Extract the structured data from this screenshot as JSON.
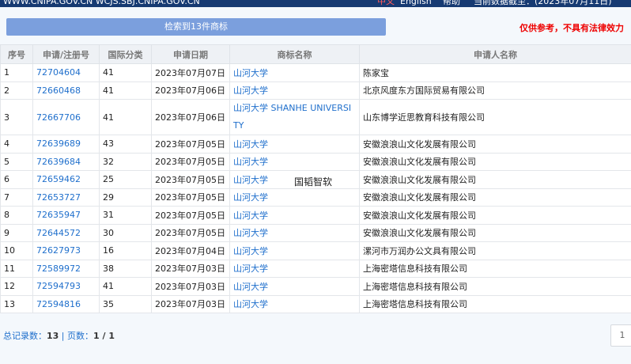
{
  "header": {
    "site": "WWW.CNIPA.GOV.CN  WCJS.SBJ.CNIPA.GOV.CN",
    "lang_zh": "中文",
    "lang_en": "English",
    "help": "帮助",
    "data_as_of": "当前数据截至：(2023年07月11日)"
  },
  "search_result_bar": "检索到13件商标",
  "disclaimer": "仅供参考，不具有法律效力",
  "table": {
    "headers": [
      "序号",
      "申请/注册号",
      "国际分类",
      "申请日期",
      "商标名称",
      "申请人名称"
    ],
    "rows": [
      [
        "1",
        "72704604",
        "41",
        "2023年07月07日",
        "山河大学",
        "陈家宝"
      ],
      [
        "2",
        "72660468",
        "41",
        "2023年07月06日",
        "山河大学",
        "北京风度东方国际贸易有限公司"
      ],
      [
        "3",
        "72667706",
        "41",
        "2023年07月06日",
        "山河大学 SHANHE UNIVERSITY",
        "山东博学近思教育科技有限公司"
      ],
      [
        "4",
        "72639689",
        "43",
        "2023年07月05日",
        "山河大学",
        "安徽浪浪山文化发展有限公司"
      ],
      [
        "5",
        "72639684",
        "32",
        "2023年07月05日",
        "山河大学",
        "安徽浪浪山文化发展有限公司"
      ],
      [
        "6",
        "72659462",
        "25",
        "2023年07月05日",
        "山河大学",
        "安徽浪浪山文化发展有限公司"
      ],
      [
        "7",
        "72653727",
        "29",
        "2023年07月05日",
        "山河大学",
        "安徽浪浪山文化发展有限公司"
      ],
      [
        "8",
        "72635947",
        "31",
        "2023年07月05日",
        "山河大学",
        "安徽浪浪山文化发展有限公司"
      ],
      [
        "9",
        "72644572",
        "30",
        "2023年07月05日",
        "山河大学",
        "安徽浪浪山文化发展有限公司"
      ],
      [
        "10",
        "72627973",
        "16",
        "2023年07月04日",
        "山河大学",
        "漯河市万润办公文具有限公司"
      ],
      [
        "11",
        "72589972",
        "38",
        "2023年07月03日",
        "山河大学",
        "上海密塔信息科技有限公司"
      ],
      [
        "12",
        "72594793",
        "41",
        "2023年07月03日",
        "山河大学",
        "上海密塔信息科技有限公司"
      ],
      [
        "13",
        "72594816",
        "35",
        "2023年07月03日",
        "山河大学",
        "上海密塔信息科技有限公司"
      ]
    ]
  },
  "watermark": "国韬智软",
  "footer": {
    "total_label": "总记录数：",
    "total": "13",
    "sep": " | ",
    "pages_label": "页数：",
    "pages": "1 / 1"
  },
  "pager": {
    "current": "1"
  },
  "colors": {
    "accent": "#1f6fcc",
    "topbar": "#163a72",
    "searchbar": "#7b9fdd",
    "warning": "#ee0000"
  }
}
